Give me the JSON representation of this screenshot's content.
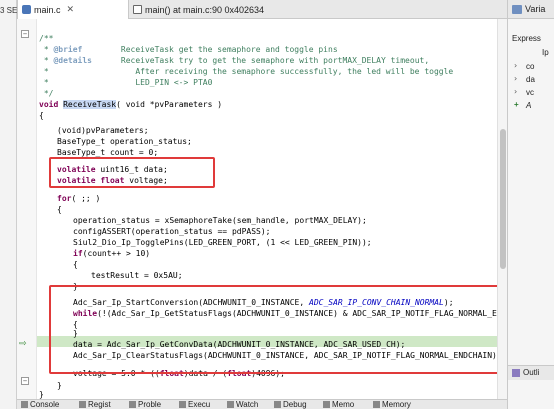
{
  "left_panel": {
    "label": "3 SE"
  },
  "tabs": [
    {
      "label": "main.c",
      "close": "✕",
      "icon": "c-file-icon"
    },
    {
      "label": "main() at main.c:90 0x402634",
      "icon": "debug-frame-icon"
    }
  ],
  "right_panel": {
    "title": "Varia",
    "express_label": "Express",
    "col_label": "Ip",
    "items": [
      "co",
      "da",
      "vc"
    ],
    "add_label": "A",
    "outline_label": "Outli"
  },
  "code": {
    "doc_open": "/**",
    "brief_tag": "@brief",
    "brief_text": "ReceiveTask get the semaphore and toggle pins",
    "details_tag": "@details",
    "details_text1": "ReceiveTask try to get the semaphore with portMAX_DELAY timeout,",
    "details_text2": "After receiving the semaphore successfully, the led will be toggle",
    "details_text3": "LED_PIN <-> PTA0",
    "doc_close": "*/",
    "sig_void": "void",
    "sig_name": "ReceiveTask",
    "sig_params": "( void *pvParameters )",
    "brace_open": "{",
    "l_cast": "(void)pvParameters;",
    "l_status": "BaseType_t operation_status;",
    "l_count": "BaseType_t count = 0;",
    "l_volatile1_kw": "volatile",
    "l_volatile1_rest": " uint16_t data;",
    "l_volatile2_kw": "volatile float",
    "l_volatile2_rest": " voltage;",
    "for_kw": "for",
    "for_rest": "( ;; )",
    "for_open": "{",
    "take": "operation_status = xSemaphoreTake(sem_handle, portMAX_DELAY);",
    "assert": "configASSERT(operation_status == pdPASS);",
    "toggle": "Siul2_Dio_Ip_TogglePins(LED_GREEN_PORT, (1 << LED_GREEN_PIN));",
    "if_kw": "if",
    "if_rest": "(count++ > 10)",
    "if_open": "{",
    "test": "testResult = 0x5AU;",
    "if_close": "}",
    "adc_start_a": "Adc_Sar_Ip_StartConversion(ADCHWUNIT_0_INSTANCE, ",
    "adc_start_b": "ADC_SAR_IP_CONV_CHAIN_NORMAL",
    "adc_start_c": ");",
    "while_kw": "while",
    "while_rest": "(!(Adc_Sar_Ip_GetStatusFlags(ADCHWUNIT_0_INSTANCE) & ADC_SAR_IP_NOTIF_FLAG_NORMAL_ENDCHAIN",
    "w_open": "{",
    "w_close": "}",
    "getconv": "data = Adc_Sar_Ip_GetConvData(ADCHWUNIT_0_INSTANCE, ADC_SAR_USED_CH);",
    "clear": "Adc_Sar_Ip_ClearStatusFlags(ADCHWUNIT_0_INSTANCE, ADC_SAR_IP_NOTIF_FLAG_NORMAL_ENDCHAIN);",
    "voltage_a": "voltage = 5.0 * ((",
    "voltage_kw1": "float",
    "voltage_b": ")data / (",
    "voltage_kw2": "float",
    "voltage_c": ")4096);",
    "for_close": "}",
    "fn_close": "}",
    "next_doc": "/**",
    "next_star": "*"
  },
  "bottom_tabs": [
    "Console",
    "Regist",
    "Proble",
    "Execu",
    "Watch",
    "Debug",
    "Memo",
    "Memory"
  ]
}
